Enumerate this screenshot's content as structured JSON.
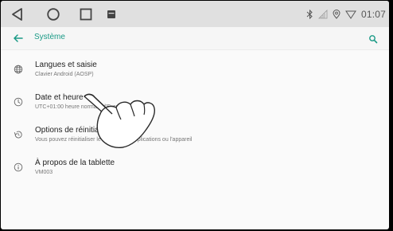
{
  "status_bar": {
    "time": "01:07",
    "icons": [
      "bluetooth-icon",
      "signal-icon",
      "location-icon",
      "wifi-icon"
    ]
  },
  "nav_bar": {
    "icons": [
      "back-triangle-icon",
      "home-circle-icon",
      "recent-square-icon",
      "screenshot-icon"
    ]
  },
  "app_bar": {
    "title": "Système",
    "back_icon": "arrow-left-icon",
    "search_icon": "search-icon",
    "accent_color": "#1a9a86"
  },
  "settings": [
    {
      "icon": "globe-icon",
      "title": "Langues et saisie",
      "subtitle": "Clavier Android (AOSP)"
    },
    {
      "icon": "clock-icon",
      "title": "Date et heure",
      "subtitle": "UTC+01:00 heure normale d'Europe centrale"
    },
    {
      "icon": "restore-icon",
      "title": "Options de réinitialisation",
      "subtitle": "Vous pouvez réinitialiser le réseau, les applications ou l'appareil"
    },
    {
      "icon": "info-icon",
      "title": "À propos de la tablette",
      "subtitle": "VM003"
    }
  ],
  "overlay": {
    "icon": "pointing-hand-icon"
  }
}
